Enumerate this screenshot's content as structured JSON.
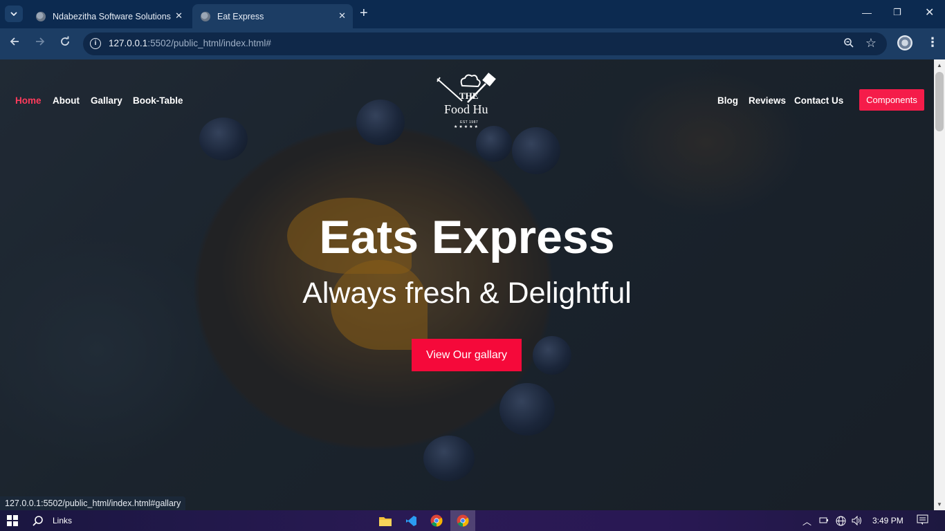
{
  "browser": {
    "tabs": [
      {
        "title": "Ndabezitha Software Solutions",
        "active": false
      },
      {
        "title": "Eat Express",
        "active": true
      }
    ],
    "url_host": "127.0.0.1",
    "url_rest": ":5502/public_html/index.html#",
    "status_url": "127.0.0.1:5502/public_html/index.html#gallary"
  },
  "site": {
    "nav_left": [
      "Home",
      "About",
      "Gallary",
      "Book-Table"
    ],
    "nav_right": [
      "Blog",
      "Reviews",
      "Contact Us"
    ],
    "components_button": "Components",
    "logo": {
      "the": "THE",
      "name": "Food Hu",
      "est": "EST 1987",
      "stars": "★★★★★"
    },
    "hero_title": "Eats Express",
    "hero_subtitle": "Always fresh & Delightful",
    "hero_button": "View Our gallary",
    "accent_color": "#f5093a",
    "active_nav_color": "#ff3b5c"
  },
  "taskbar": {
    "search_label": "Links",
    "time": "3:49 PM"
  }
}
